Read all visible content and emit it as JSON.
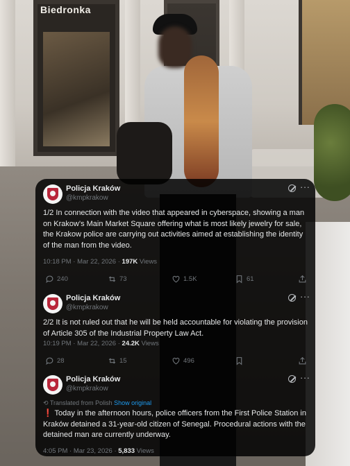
{
  "photo": {
    "shop_sign": "Biedronka"
  },
  "tweets": [
    {
      "name": "Policja Kraków",
      "handle": "@kmpkrakow",
      "text": "1/2 In connection with the video that appeared in cyberspace, showing a man on Krakow's Main Market Square offering what is most likely jewelry for sale, the Krakow police are carrying out activities aimed at establishing the identity of the man from the video.",
      "time": "10:18 PM · Mar 22, 2026 · ",
      "views_count": "197K",
      "views_label": " Views",
      "replies": "240",
      "reposts": "73",
      "likes": "1.5K",
      "bookmarks": "61"
    },
    {
      "name": "Policja Kraków",
      "handle": "@kmpkrakow",
      "text": "2/2 It is not ruled out that he will be held accountable for violating the provision of Article 305 of the Industrial Property Law Act.",
      "time": "10:19 PM · Mar 22, 2026 · ",
      "views_count": "24.2K",
      "views_label": " Views",
      "replies": "28",
      "reposts": "15",
      "likes": "496",
      "bookmarks": ""
    },
    {
      "name": "Policja Kraków",
      "handle": "@kmpkrakow",
      "translated_label": "Translated from Polish ",
      "show_original": "Show original",
      "bang": "❗",
      "text": " Today in the afternoon hours, police officers from the First Police Station in Kraków detained a 31-year-old citizen of Senegal. Procedural actions with the detained man are currently underway.",
      "time": "4:05 PM · Mar 23, 2026 · ",
      "views_count": "5,833",
      "views_label": " Views"
    }
  ],
  "colors": {
    "overlay": "#000000",
    "text": "#e7e9ea",
    "muted": "#71767b",
    "link": "#1d9bf0"
  }
}
